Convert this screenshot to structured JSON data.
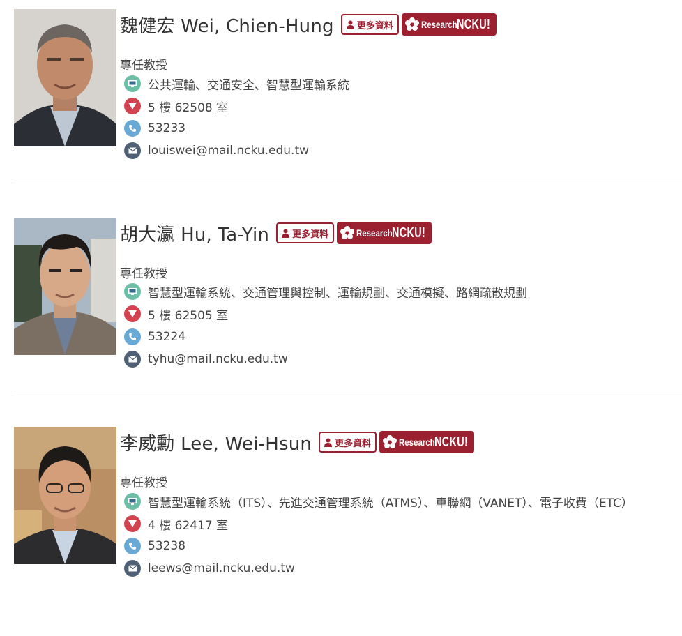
{
  "buttons": {
    "more_label": "更多資料",
    "research_label": "Research",
    "ncku_label": "NCKU!"
  },
  "people": [
    {
      "name": "魏健宏 Wei, Chien-Hung",
      "title": "專任教授",
      "research": "公共運輸、交通安全、智慧型運輸系統",
      "room": "5 樓 62508 室",
      "phone": "53233",
      "email": "louiswei@mail.ncku.edu.tw"
    },
    {
      "name": "胡大瀛 Hu, Ta-Yin",
      "title": "專任教授",
      "research": "智慧型運輸系統、交通管理與控制、運輸規劃、交通模擬、路網疏散規劃",
      "room": "5 樓 62505 室",
      "phone": "53224",
      "email": "tyhu@mail.ncku.edu.tw"
    },
    {
      "name": "李威勳 Lee, Wei-Hsun",
      "title": "專任教授",
      "research": "智慧型運輸系統（ITS）、先進交通管理系統（ATMS）、車聯網（VANET）、電子收費（ETC）",
      "room": "4 樓 62417 室",
      "phone": "53238",
      "email": "leews@mail.ncku.edu.tw"
    }
  ],
  "colors": {
    "accent": "#9b2131",
    "research_icon": "#6cbfa6",
    "room_icon": "#d2434f",
    "phone_icon": "#6aa9d6",
    "mail_icon": "#4f5f74"
  },
  "icons": {
    "more": "user-icon",
    "research": "monitor-icon",
    "room": "location-pin-icon",
    "phone": "phone-icon",
    "mail": "envelope-icon"
  }
}
